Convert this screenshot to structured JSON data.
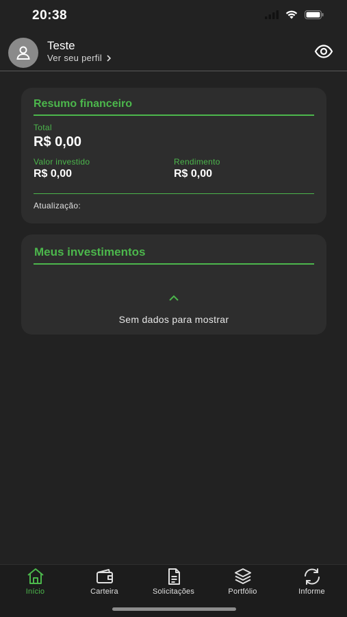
{
  "status_bar": {
    "time": "20:38"
  },
  "header": {
    "user_name": "Teste",
    "profile_link": "Ver seu perfil"
  },
  "summary_card": {
    "title": "Resumo financeiro",
    "total_label": "Total",
    "total_value": "R$ 0,00",
    "invested_label": "Valor investido",
    "invested_value": "R$ 0,00",
    "yield_label": "Rendimento",
    "yield_value": "R$ 0,00",
    "update_label": "Atualização:"
  },
  "investments_card": {
    "title": "Meus investimentos",
    "empty_text": "Sem dados para mostrar"
  },
  "tabs": [
    {
      "label": "Início",
      "icon": "home-icon",
      "active": true
    },
    {
      "label": "Carteira",
      "icon": "wallet-icon",
      "active": false
    },
    {
      "label": "Solicitações",
      "icon": "document-icon",
      "active": false
    },
    {
      "label": "Portfólio",
      "icon": "layers-icon",
      "active": false
    },
    {
      "label": "Informe",
      "icon": "refresh-icon",
      "active": false
    }
  ],
  "colors": {
    "accent": "#4cb74c",
    "background": "#222222",
    "card": "#2d2d2d"
  }
}
